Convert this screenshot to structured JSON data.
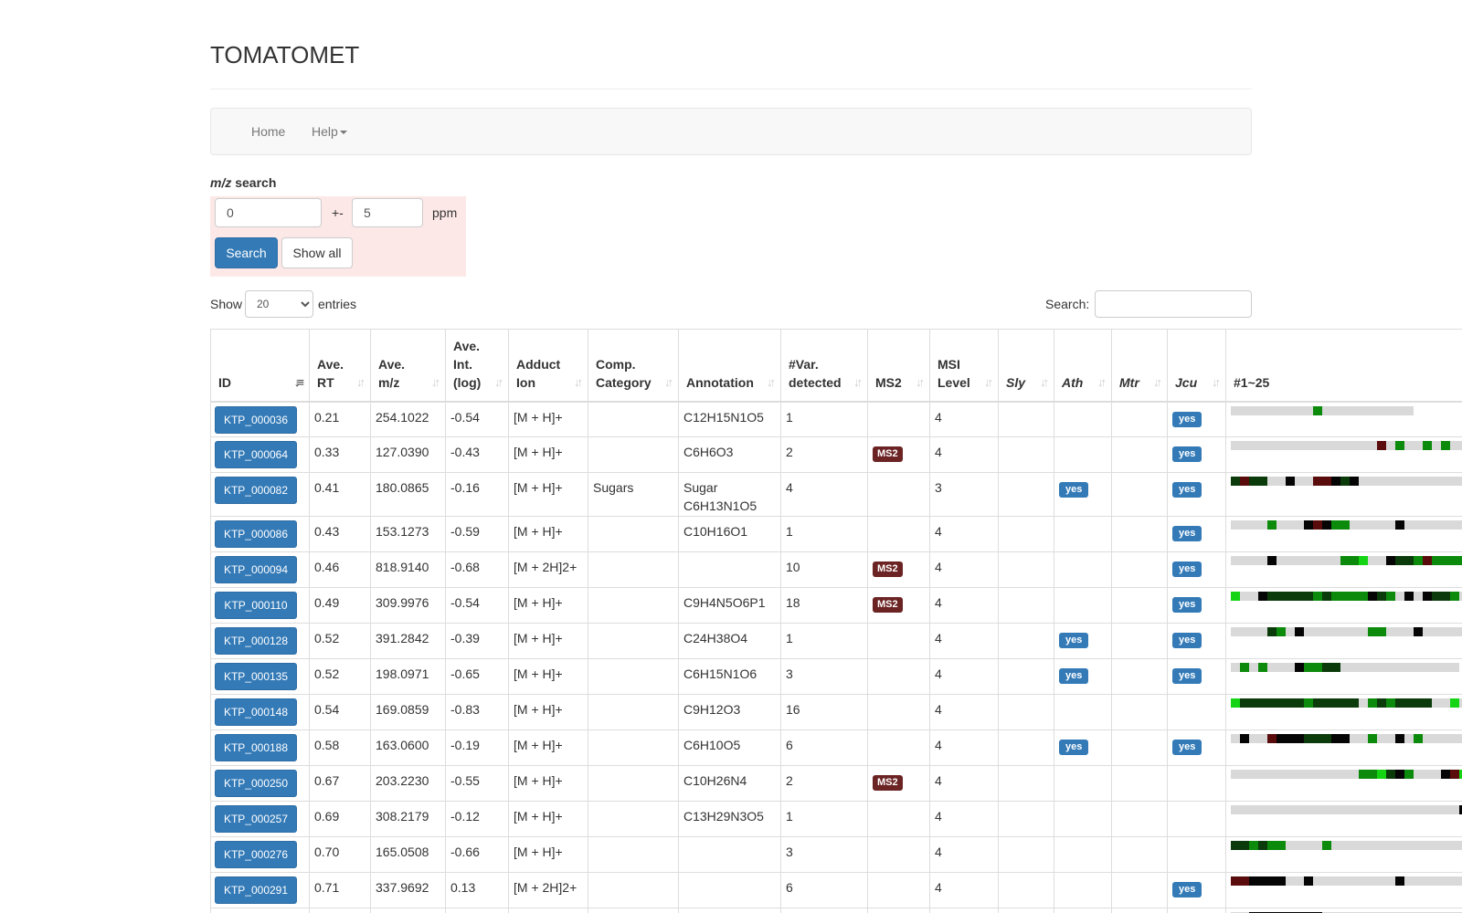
{
  "app": {
    "title": "TOMATOMET"
  },
  "nav": {
    "items": [
      {
        "label": "Home"
      },
      {
        "label": "Help"
      }
    ]
  },
  "mz_search": {
    "label_italic": "m/z",
    "label_rest": " search",
    "mz_value": "0",
    "plusminus": "+-",
    "tolerance_value": "5",
    "unit": "ppm",
    "search_button": "Search",
    "showall_button": "Show all"
  },
  "table_controls": {
    "show_label": "Show",
    "entries_value": "20",
    "entries_options": [
      "20"
    ],
    "entries_label": "entries",
    "search_label": "Search:",
    "search_value": ""
  },
  "colors": {
    "heat_empty": "#d9d9d9",
    "heat_bright": "#14d414",
    "heat_green": "#0c8a0c",
    "heat_dark": "#0b3a0b",
    "heat_black": "#050505",
    "heat_red": "#5a0b0b",
    "badge_yes": "#337ab7",
    "badge_ms2": "#6b2323"
  },
  "table": {
    "columns": [
      {
        "label": "ID",
        "sorted": true
      },
      {
        "label": "Ave. RT"
      },
      {
        "label": "Ave. m/z"
      },
      {
        "label": "Ave. Int. (log)"
      },
      {
        "label": "Adduct Ion"
      },
      {
        "label": "Comp. Category"
      },
      {
        "label": "Annotation"
      },
      {
        "label": "#Var. detected"
      },
      {
        "label": "MS2"
      },
      {
        "label": "MSI Level"
      },
      {
        "label": "Sly",
        "italic": true
      },
      {
        "label": "Ath",
        "italic": true
      },
      {
        "label": "Mtr",
        "italic": true
      },
      {
        "label": "Jcu",
        "italic": true
      },
      {
        "label": "#1~25",
        "nosort": true
      }
    ],
    "rows": [
      {
        "id": "KTP_000036",
        "rt": "0.21",
        "mz": "254.1022",
        "int": "-0.54",
        "adduct": "[M + H]+",
        "category": "",
        "annotation": "C12H15N1O5",
        "var": "1",
        "ms2": "",
        "msi": "4",
        "sly": "",
        "ath": "",
        "mtr": "",
        "jcu": "yes",
        "heat": "eeeeeeeeegeeeeeeeeee"
      },
      {
        "id": "KTP_000064",
        "rt": "0.33",
        "mz": "127.0390",
        "int": "-0.43",
        "adduct": "[M + H]+",
        "category": "",
        "annotation": "C6H6O3",
        "var": "2",
        "ms2": "MS2",
        "msi": "4",
        "sly": "",
        "ath": "",
        "mtr": "",
        "jcu": "yes",
        "heat": "eeeeeeeeeeeeeeeeregeegegeee"
      },
      {
        "id": "KTP_000082",
        "rt": "0.41",
        "mz": "180.0865",
        "int": "-0.16",
        "adduct": "[M + H]+",
        "category": "Sugars",
        "annotation": "Sugar C6H13N1O5",
        "var": "4",
        "ms2": "",
        "msi": "3",
        "sly": "",
        "ath": "yes",
        "mtr": "",
        "jcu": "yes",
        "heat": "drddeekeerrkdkeeeeeeeeeeee",
        "tall": true
      },
      {
        "id": "KTP_000086",
        "rt": "0.43",
        "mz": "153.1273",
        "int": "-0.59",
        "adduct": "[M + H]+",
        "category": "",
        "annotation": "C10H16O1",
        "var": "1",
        "ms2": "",
        "msi": "4",
        "sly": "",
        "ath": "",
        "mtr": "",
        "jcu": "yes",
        "heat": "eeeegeeekrkggeeeeekeeeeeee"
      },
      {
        "id": "KTP_000094",
        "rt": "0.46",
        "mz": "818.9140",
        "int": "-0.68",
        "adduct": "[M + 2H]2+",
        "category": "",
        "annotation": "",
        "var": "10",
        "ms2": "MS2",
        "msi": "4",
        "sly": "",
        "ath": "",
        "mtr": "",
        "jcu": "yes",
        "heat": "eeeekeeeeeeeggbeekddgrgggg"
      },
      {
        "id": "KTP_000110",
        "rt": "0.49",
        "mz": "309.9976",
        "int": "-0.54",
        "adduct": "[M + H]+",
        "category": "",
        "annotation": "C9H4N5O6P1",
        "var": "18",
        "ms2": "MS2",
        "msi": "4",
        "sly": "",
        "ath": "",
        "mtr": "",
        "jcu": "yes",
        "heat": "beekdddddgdggggkdgekekddge"
      },
      {
        "id": "KTP_000128",
        "rt": "0.52",
        "mz": "391.2842",
        "int": "-0.39",
        "adduct": "[M + H]+",
        "category": "",
        "annotation": "C24H38O4",
        "var": "1",
        "ms2": "",
        "msi": "4",
        "sly": "",
        "ath": "yes",
        "mtr": "",
        "jcu": "yes",
        "heat": "eeeedgekeeeeeeeggeeekeeeeeee"
      },
      {
        "id": "KTP_000135",
        "rt": "0.52",
        "mz": "198.0971",
        "int": "-0.65",
        "adduct": "[M + H]+",
        "category": "",
        "annotation": "C6H15N1O6",
        "var": "3",
        "ms2": "",
        "msi": "4",
        "sly": "",
        "ath": "yes",
        "mtr": "",
        "jcu": "yes",
        "heat": "egegeeekggddeeeeeeeeeeeee"
      },
      {
        "id": "KTP_000148",
        "rt": "0.54",
        "mz": "169.0859",
        "int": "-0.83",
        "adduct": "[M + H]+",
        "category": "",
        "annotation": "C9H12O3",
        "var": "16",
        "ms2": "",
        "msi": "4",
        "sly": "",
        "ath": "",
        "mtr": "",
        "jcu": "",
        "heat": "bdddddddgdddddegdgddddeebe"
      },
      {
        "id": "KTP_000188",
        "rt": "0.58",
        "mz": "163.0600",
        "int": "-0.19",
        "adduct": "[M + H]+",
        "category": "",
        "annotation": "C6H10O5",
        "var": "6",
        "ms2": "",
        "msi": "4",
        "sly": "",
        "ath": "yes",
        "mtr": "",
        "jcu": "yes",
        "heat": "ekeerkkkdddkkeegeekegeeeee"
      },
      {
        "id": "KTP_000250",
        "rt": "0.67",
        "mz": "203.2230",
        "int": "-0.55",
        "adduct": "[M + H]+",
        "category": "",
        "annotation": "C10H26N4",
        "var": "2",
        "ms2": "MS2",
        "msi": "4",
        "sly": "",
        "ath": "",
        "mtr": "",
        "jcu": "",
        "heat": "eeeeeeeeeeeeeeggbdkgeeekrb"
      },
      {
        "id": "KTP_000257",
        "rt": "0.69",
        "mz": "308.2179",
        "int": "-0.12",
        "adduct": "[M + H]+",
        "category": "",
        "annotation": "C13H29N3O5",
        "var": "1",
        "ms2": "",
        "msi": "4",
        "sly": "",
        "ath": "",
        "mtr": "",
        "jcu": "",
        "heat": "eeeeeeeeeeeeeeeeeeeeeeeeek"
      },
      {
        "id": "KTP_000276",
        "rt": "0.70",
        "mz": "165.0508",
        "int": "-0.66",
        "adduct": "[M + H]+",
        "category": "",
        "annotation": "",
        "var": "3",
        "ms2": "",
        "msi": "4",
        "sly": "",
        "ath": "",
        "mtr": "",
        "jcu": "",
        "heat": "ddgdggeeeegeeeeeeeeeeeeeee"
      },
      {
        "id": "KTP_000291",
        "rt": "0.71",
        "mz": "337.9692",
        "int": "0.13",
        "adduct": "[M + 2H]2+",
        "category": "",
        "annotation": "",
        "var": "6",
        "ms2": "",
        "msi": "4",
        "sly": "",
        "ath": "",
        "mtr": "",
        "jcu": "yes",
        "heat": "rrkkkkeekeeeeeeeeekeeeeeee"
      },
      {
        "id": "",
        "rt": "",
        "mz": "",
        "int": "",
        "adduct": "",
        "category": "",
        "annotation": "",
        "var": "",
        "ms2": "",
        "msi": "",
        "sly": "",
        "ath": "",
        "mtr": "",
        "jcu": "",
        "heat": "eekkkkkkkkeeeeeeeeeeeeeeee",
        "partial": true
      }
    ]
  }
}
